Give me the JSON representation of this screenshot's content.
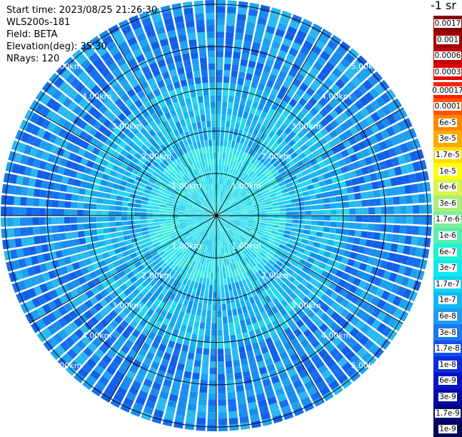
{
  "info": {
    "start_time": "Start time: 2023/08/25 21:26:30",
    "device": "WLS200s-181",
    "field": "Field: BETA",
    "elevation": "Elevation(deg): 35.30",
    "nrays": "NRays: 120"
  },
  "colorbar": {
    "unit_label": "-1 sr",
    "entries": [
      {
        "label": "0.0017",
        "color": "#8b0000"
      },
      {
        "label": "0.001",
        "color": "#a20000"
      },
      {
        "label": "0.0006",
        "color": "#c40000"
      },
      {
        "label": "0.0003",
        "color": "#e60000"
      },
      {
        "label": "0.00017",
        "color": "#ff2200"
      },
      {
        "label": "0.0001",
        "color": "#ff5500"
      },
      {
        "label": "6e-5",
        "color": "#ff8800"
      },
      {
        "label": "3e-5",
        "color": "#ffaa00"
      },
      {
        "label": "1.7e-5",
        "color": "#ffdd00"
      },
      {
        "label": "1e-5",
        "color": "#ffff00"
      },
      {
        "label": "6e-6",
        "color": "#d8f54a"
      },
      {
        "label": "3e-6",
        "color": "#a8f07a"
      },
      {
        "label": "1.7e-6",
        "color": "#80ee98"
      },
      {
        "label": "1e-6",
        "color": "#55f0b0"
      },
      {
        "label": "6e-7",
        "color": "#22f0d0"
      },
      {
        "label": "3e-7",
        "color": "#10e8f0"
      },
      {
        "label": "1.7e-7",
        "color": "#10d0f0"
      },
      {
        "label": "1e-7",
        "color": "#10b8f0"
      },
      {
        "label": "6e-8",
        "color": "#1d9cf0"
      },
      {
        "label": "3e-8",
        "color": "#1a78ee"
      },
      {
        "label": "1.7e-8",
        "color": "#1250ee"
      },
      {
        "label": "1e-8",
        "color": "#0a2ce0"
      },
      {
        "label": "6e-9",
        "color": "#0614c6"
      },
      {
        "label": "3e-9",
        "color": "#050aa8"
      },
      {
        "label": "1.7e-9",
        "color": "#03077e"
      },
      {
        "label": "1e-9",
        "color": "#020558"
      }
    ]
  },
  "plot": {
    "range_labels": [
      "1.00km",
      "2.00km",
      "3.00km",
      "4.00km",
      "5.00km"
    ],
    "ring_ranges_km": [
      1,
      2,
      3,
      4,
      5
    ],
    "max_range_km": 5.1,
    "spoke_angles_deg": [
      0,
      30,
      60,
      90,
      120,
      150
    ],
    "nrays": 120,
    "range_gates": 34,
    "colors": {
      "inner_palette": [
        "#38e8ee",
        "#2ce0f0",
        "#46ecd6",
        "#30d8f0",
        "#22c8f0"
      ],
      "middle_palette": [
        "#18b4f0",
        "#1ea8f0",
        "#2bc4f0",
        "#1290ee",
        "#26d8ea"
      ],
      "outer_palette": [
        "#1a8cee",
        "#1670ee",
        "#1ea2f0",
        "#1260e8",
        "#2ab8f0"
      ]
    }
  }
}
